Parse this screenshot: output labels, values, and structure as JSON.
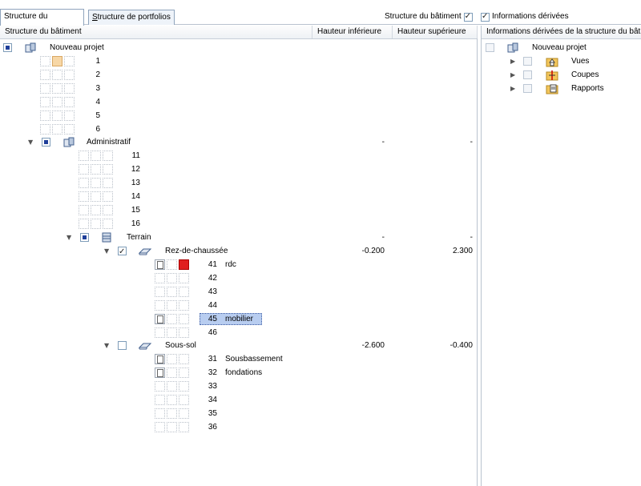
{
  "tabs": [
    {
      "label": "Structure du bâtiment",
      "active": true
    },
    {
      "label": "Structure de portfolios",
      "underline": "S",
      "rest": "tructure de portfolios",
      "active": false
    }
  ],
  "toggles": {
    "building_structure": {
      "label": "Structure du bâtiment",
      "checked": true
    },
    "derived_info": {
      "label": "Informations dérivées",
      "checked": true
    }
  },
  "left_panel": {
    "columns": [
      "Structure du bâtiment",
      "Hauteur inférieure",
      "Hauteur supérieure"
    ],
    "project": "Nouveau projet",
    "project_slots": [
      "1",
      "2",
      "3",
      "4",
      "5",
      "6"
    ],
    "administratif": {
      "label": "Administratif",
      "lower": "-",
      "upper": "-",
      "slots": [
        "11",
        "12",
        "13",
        "14",
        "15",
        "16"
      ]
    },
    "terrain": {
      "label": "Terrain",
      "lower": "-",
      "upper": "-"
    },
    "rdc": {
      "label": "Rez-de-chaussée",
      "lower": "-0.200",
      "upper": "2.300",
      "slots": [
        {
          "num": "41",
          "name": "rdc"
        },
        {
          "num": "42",
          "name": ""
        },
        {
          "num": "43",
          "name": ""
        },
        {
          "num": "44",
          "name": ""
        },
        {
          "num": "45",
          "name": "mobilier"
        },
        {
          "num": "46",
          "name": ""
        }
      ]
    },
    "soussol": {
      "label": "Sous-sol",
      "lower": "-2.600",
      "upper": "-0.400",
      "slots": [
        {
          "num": "31",
          "name": "Sousbassement"
        },
        {
          "num": "32",
          "name": "fondations"
        },
        {
          "num": "33",
          "name": ""
        },
        {
          "num": "34",
          "name": ""
        },
        {
          "num": "35",
          "name": ""
        },
        {
          "num": "36",
          "name": ""
        }
      ]
    }
  },
  "right_panel": {
    "header": "Informations dérivées de la structure du bâtiment",
    "project": "Nouveau projet",
    "items": [
      "Vues",
      "Coupes",
      "Rapports"
    ]
  },
  "colors": {
    "selection": "#b8cdf0",
    "accent": "#1f3f9a",
    "layer_red": "#e01e1e",
    "slot_orange": "#f7d7a6"
  }
}
